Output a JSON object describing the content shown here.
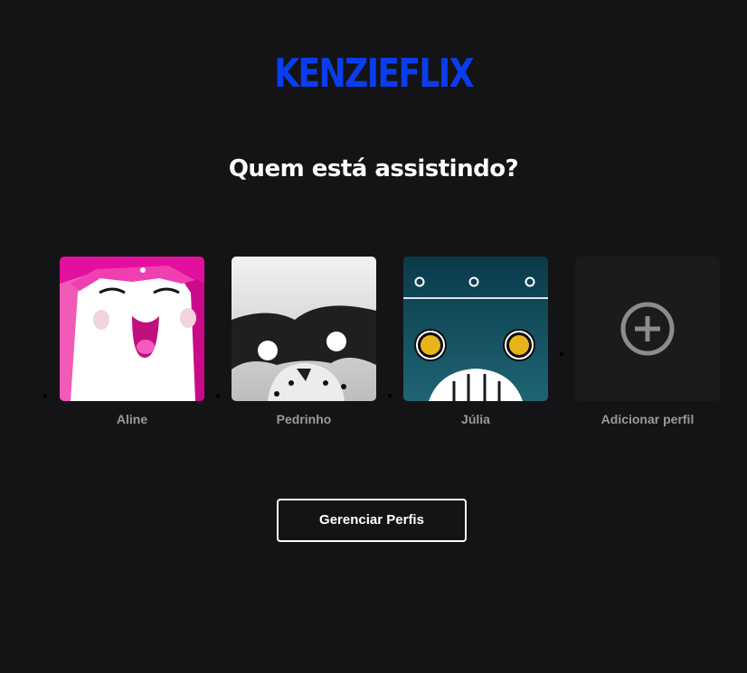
{
  "brand": {
    "logo_text": "KENZIEFLIX",
    "color": "#0a3df0"
  },
  "heading": "Quem está assistindo?",
  "profiles": [
    {
      "name": "Aline",
      "avatar": "pink-happy-face-avatar",
      "color": "#e0109a"
    },
    {
      "name": "Pedrinho",
      "avatar": "raccoon-mask-avatar",
      "color": "#222222"
    },
    {
      "name": "Júlia",
      "avatar": "teal-robot-avatar",
      "color": "#0e4a5c"
    }
  ],
  "add_profile": {
    "label": "Adicionar perfil",
    "icon": "plus-circle-icon"
  },
  "manage_button": {
    "label": "Gerenciar Perfis"
  }
}
